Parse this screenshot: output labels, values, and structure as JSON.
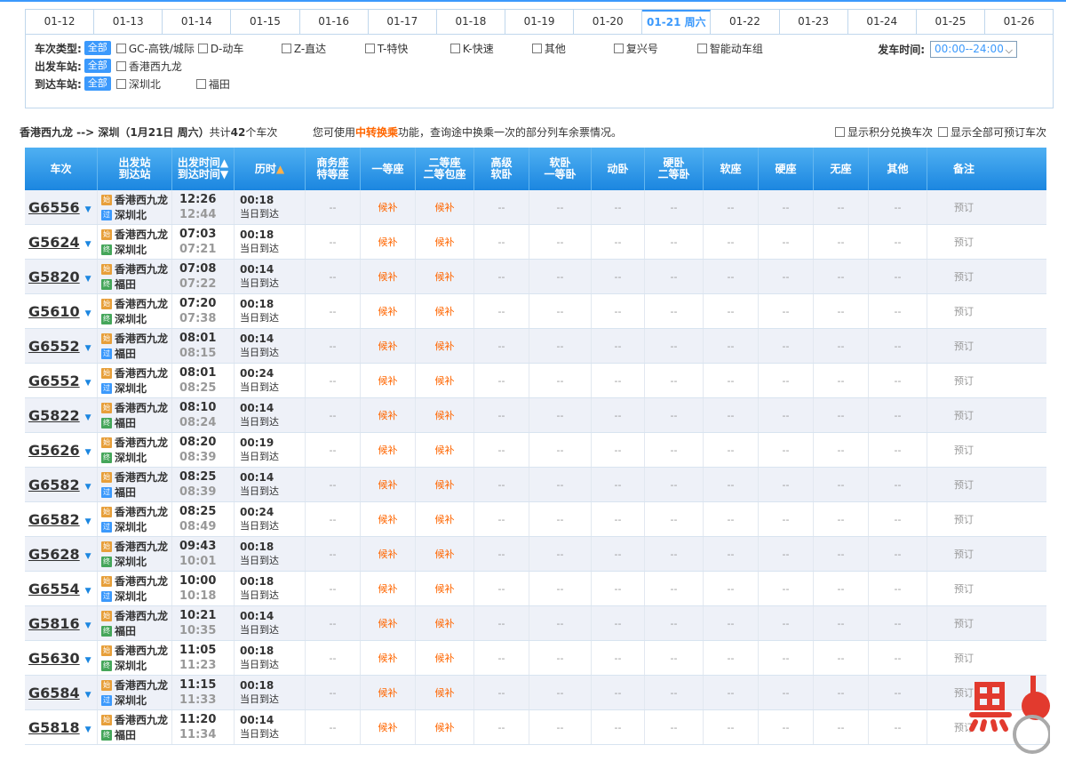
{
  "date_tabs": [
    {
      "label": "01-12",
      "active": false
    },
    {
      "label": "01-13",
      "active": false
    },
    {
      "label": "01-14",
      "active": false
    },
    {
      "label": "01-15",
      "active": false
    },
    {
      "label": "01-16",
      "active": false
    },
    {
      "label": "01-17",
      "active": false
    },
    {
      "label": "01-18",
      "active": false
    },
    {
      "label": "01-19",
      "active": false
    },
    {
      "label": "01-20",
      "active": false
    },
    {
      "label": "01-21 周六",
      "active": true
    },
    {
      "label": "01-22",
      "active": false
    },
    {
      "label": "01-23",
      "active": false
    },
    {
      "label": "01-24",
      "active": false
    },
    {
      "label": "01-25",
      "active": false
    },
    {
      "label": "01-26",
      "active": false
    }
  ],
  "filter": {
    "train_type_label": "车次类型:",
    "all_label": "全部",
    "train_types": [
      "GC-高铁/城际",
      "D-动车",
      "Z-直达",
      "T-特快",
      "K-快速",
      "其他",
      "复兴号",
      "智能动车组"
    ],
    "from_label": "出发车站:",
    "from_stations": [
      "香港西九龙"
    ],
    "to_label": "到达车站:",
    "to_stations": [
      "深圳北",
      "福田"
    ],
    "time_label": "发车时间:",
    "time_value": "00:00--24:00"
  },
  "info": {
    "route": "香港西九龙 --> 深圳（1月21日  周六）",
    "total_prefix": "共计",
    "total_count": "42",
    "total_suffix": "个车次",
    "tip_prefix": "您可使用",
    "tip_highlight": "中转换乘",
    "tip_suffix": "功能，查询途中换乘一次的部分列车余票情况。",
    "opt_points": "显示积分兑换车次",
    "opt_all": "显示全部可预订车次"
  },
  "headers": {
    "train": "车次",
    "stations_1": "出发站",
    "stations_2": "到达站",
    "time_1": "出发时间",
    "time_2": "到达时间",
    "duration": "历时",
    "business_1": "商务座",
    "business_2": "特等座",
    "first": "一等座",
    "second_1": "二等座",
    "second_2": "二等包座",
    "premium_1": "高级",
    "premium_2": "软卧",
    "soft_1": "软卧",
    "soft_2": "一等卧",
    "moving": "动卧",
    "hard_1": "硬卧",
    "hard_2": "二等卧",
    "soft_seat": "软座",
    "hard_seat": "硬座",
    "no_seat": "无座",
    "other": "其他",
    "note": "备注"
  },
  "common": {
    "dash": "--",
    "houbu": "候补",
    "book": "预订",
    "same_day": "当日到达",
    "icon_start": "始",
    "icon_end": "终",
    "icon_pass": "过"
  },
  "trains": [
    {
      "no": "G6556",
      "from": "香港西九龙",
      "to": "深圳北",
      "to_icon": "pass",
      "dep": "12:26",
      "arr": "12:44",
      "dur": "00:18"
    },
    {
      "no": "G5624",
      "from": "香港西九龙",
      "to": "深圳北",
      "to_icon": "end",
      "dep": "07:03",
      "arr": "07:21",
      "dur": "00:18"
    },
    {
      "no": "G5820",
      "from": "香港西九龙",
      "to": "福田",
      "to_icon": "end",
      "dep": "07:08",
      "arr": "07:22",
      "dur": "00:14"
    },
    {
      "no": "G5610",
      "from": "香港西九龙",
      "to": "深圳北",
      "to_icon": "end",
      "dep": "07:20",
      "arr": "07:38",
      "dur": "00:18"
    },
    {
      "no": "G6552",
      "from": "香港西九龙",
      "to": "福田",
      "to_icon": "pass",
      "dep": "08:01",
      "arr": "08:15",
      "dur": "00:14"
    },
    {
      "no": "G6552",
      "from": "香港西九龙",
      "to": "深圳北",
      "to_icon": "pass",
      "dep": "08:01",
      "arr": "08:25",
      "dur": "00:24"
    },
    {
      "no": "G5822",
      "from": "香港西九龙",
      "to": "福田",
      "to_icon": "end",
      "dep": "08:10",
      "arr": "08:24",
      "dur": "00:14"
    },
    {
      "no": "G5626",
      "from": "香港西九龙",
      "to": "深圳北",
      "to_icon": "end",
      "dep": "08:20",
      "arr": "08:39",
      "dur": "00:19"
    },
    {
      "no": "G6582",
      "from": "香港西九龙",
      "to": "福田",
      "to_icon": "pass",
      "dep": "08:25",
      "arr": "08:39",
      "dur": "00:14"
    },
    {
      "no": "G6582",
      "from": "香港西九龙",
      "to": "深圳北",
      "to_icon": "pass",
      "dep": "08:25",
      "arr": "08:49",
      "dur": "00:24"
    },
    {
      "no": "G5628",
      "from": "香港西九龙",
      "to": "深圳北",
      "to_icon": "end",
      "dep": "09:43",
      "arr": "10:01",
      "dur": "00:18"
    },
    {
      "no": "G6554",
      "from": "香港西九龙",
      "to": "深圳北",
      "to_icon": "pass",
      "dep": "10:00",
      "arr": "10:18",
      "dur": "00:18"
    },
    {
      "no": "G5816",
      "from": "香港西九龙",
      "to": "福田",
      "to_icon": "end",
      "dep": "10:21",
      "arr": "10:35",
      "dur": "00:14"
    },
    {
      "no": "G5630",
      "from": "香港西九龙",
      "to": "深圳北",
      "to_icon": "end",
      "dep": "11:05",
      "arr": "11:23",
      "dur": "00:18"
    },
    {
      "no": "G6584",
      "from": "香港西九龙",
      "to": "深圳北",
      "to_icon": "pass",
      "dep": "11:15",
      "arr": "11:33",
      "dur": "00:18"
    },
    {
      "no": "G5818",
      "from": "香港西九龙",
      "to": "福田",
      "to_icon": "end",
      "dep": "11:20",
      "arr": "11:34",
      "dur": "00:14"
    }
  ],
  "colors": {
    "accent": "#3b99fc",
    "header_top": "#4fb0f2",
    "header_bottom": "#1b86e0",
    "houbu": "#ff6600",
    "row_alt": "#eef1f8",
    "logo_red": "#e23a2e"
  },
  "logo": {
    "icon": "railway-logo-icon"
  }
}
